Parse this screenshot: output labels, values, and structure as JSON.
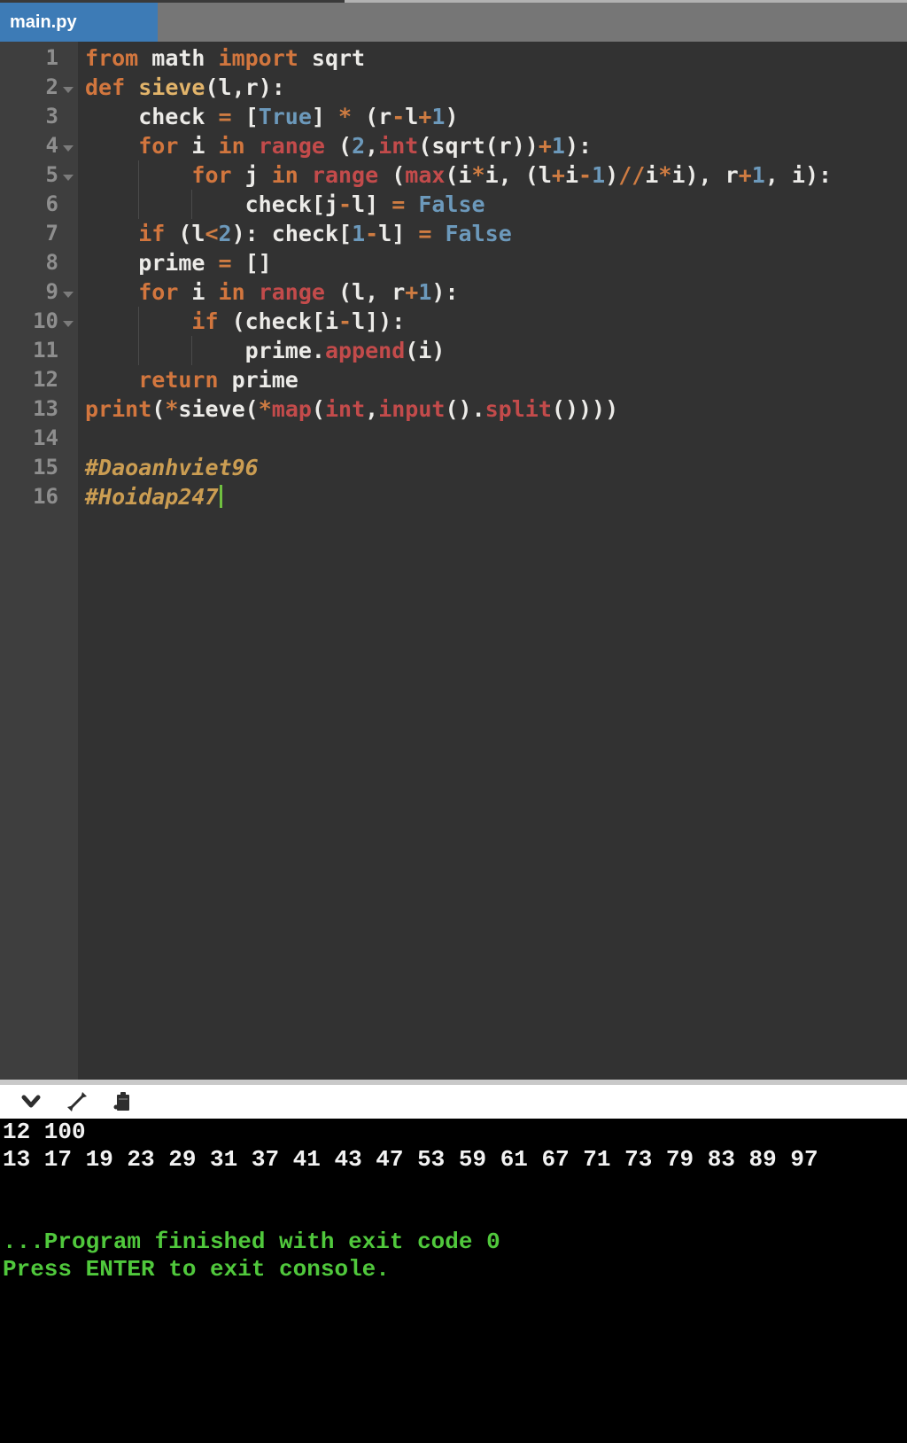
{
  "palette": {
    "tab_blue": "#3d7bb6",
    "editor_bg": "#323232",
    "gutter_bg": "#3e3e3e",
    "linenum": "#8e8e8e",
    "plain": "#ecebe8",
    "keyword": "#d2763e",
    "builtin": "#c34b4b",
    "func_def": "#e2b46a",
    "number": "#6c99bb",
    "operator": "#cf7c42",
    "comment": "#cb9d52",
    "cursor_green": "#70c040",
    "terminal_bg": "#000000",
    "terminal_text": "#f2f2f2",
    "terminal_green": "#50c83c"
  },
  "tab_bar": {
    "active_tab": "main.py"
  },
  "editor": {
    "cursor_line": 16,
    "fold_lines": [
      2,
      4,
      5,
      9,
      10
    ],
    "lines": [
      {
        "n": 1,
        "tokens": [
          [
            "kw",
            "from"
          ],
          [
            "pl",
            " math "
          ],
          [
            "kw",
            "import"
          ],
          [
            "pl",
            " sqrt"
          ]
        ]
      },
      {
        "n": 2,
        "tokens": [
          [
            "kw",
            "def"
          ],
          [
            "pl",
            " "
          ],
          [
            "fn",
            "sieve"
          ],
          [
            "pl",
            "(l,r):"
          ]
        ]
      },
      {
        "n": 3,
        "tokens": [
          [
            "pl",
            "    check "
          ],
          [
            "op",
            "="
          ],
          [
            "pl",
            " ["
          ],
          [
            "const",
            "True"
          ],
          [
            "pl",
            "] "
          ],
          [
            "op",
            "*"
          ],
          [
            "pl",
            " (r"
          ],
          [
            "op",
            "-"
          ],
          [
            "pl",
            "l"
          ],
          [
            "op",
            "+"
          ],
          [
            "num",
            "1"
          ],
          [
            "pl",
            ")"
          ]
        ]
      },
      {
        "n": 4,
        "tokens": [
          [
            "pl",
            "    "
          ],
          [
            "kw",
            "for"
          ],
          [
            "pl",
            " i "
          ],
          [
            "kw",
            "in"
          ],
          [
            "pl",
            " "
          ],
          [
            "bi",
            "range"
          ],
          [
            "pl",
            " ("
          ],
          [
            "num",
            "2"
          ],
          [
            "pl",
            ","
          ],
          [
            "bi",
            "int"
          ],
          [
            "pl",
            "(sqrt(r))"
          ],
          [
            "op",
            "+"
          ],
          [
            "num",
            "1"
          ],
          [
            "pl",
            "):"
          ]
        ]
      },
      {
        "n": 5,
        "tokens": [
          [
            "pl",
            "        "
          ],
          [
            "kw",
            "for"
          ],
          [
            "pl",
            " j "
          ],
          [
            "kw",
            "in"
          ],
          [
            "pl",
            " "
          ],
          [
            "bi",
            "range"
          ],
          [
            "pl",
            " ("
          ],
          [
            "bi",
            "max"
          ],
          [
            "pl",
            "(i"
          ],
          [
            "op",
            "*"
          ],
          [
            "pl",
            "i, (l"
          ],
          [
            "op",
            "+"
          ],
          [
            "pl",
            "i"
          ],
          [
            "op",
            "-"
          ],
          [
            "num",
            "1"
          ],
          [
            "pl",
            ")"
          ],
          [
            "op",
            "//"
          ],
          [
            "pl",
            "i"
          ],
          [
            "op",
            "*"
          ],
          [
            "pl",
            "i), r"
          ],
          [
            "op",
            "+"
          ],
          [
            "num",
            "1"
          ],
          [
            "pl",
            ", i):"
          ]
        ]
      },
      {
        "n": 6,
        "tokens": [
          [
            "pl",
            "            check[j"
          ],
          [
            "op",
            "-"
          ],
          [
            "pl",
            "l] "
          ],
          [
            "op",
            "="
          ],
          [
            "pl",
            " "
          ],
          [
            "const",
            "False"
          ]
        ]
      },
      {
        "n": 7,
        "tokens": [
          [
            "pl",
            "    "
          ],
          [
            "kw",
            "if"
          ],
          [
            "pl",
            " (l"
          ],
          [
            "op",
            "<"
          ],
          [
            "num",
            "2"
          ],
          [
            "pl",
            "): check["
          ],
          [
            "num",
            "1"
          ],
          [
            "op",
            "-"
          ],
          [
            "pl",
            "l] "
          ],
          [
            "op",
            "="
          ],
          [
            "pl",
            " "
          ],
          [
            "const",
            "False"
          ]
        ]
      },
      {
        "n": 8,
        "tokens": [
          [
            "pl",
            "    prime "
          ],
          [
            "op",
            "="
          ],
          [
            "pl",
            " []"
          ]
        ]
      },
      {
        "n": 9,
        "tokens": [
          [
            "pl",
            "    "
          ],
          [
            "kw",
            "for"
          ],
          [
            "pl",
            " i "
          ],
          [
            "kw",
            "in"
          ],
          [
            "pl",
            " "
          ],
          [
            "bi",
            "range"
          ],
          [
            "pl",
            " (l, r"
          ],
          [
            "op",
            "+"
          ],
          [
            "num",
            "1"
          ],
          [
            "pl",
            "):"
          ]
        ]
      },
      {
        "n": 10,
        "tokens": [
          [
            "pl",
            "        "
          ],
          [
            "kw",
            "if"
          ],
          [
            "pl",
            " (check[i"
          ],
          [
            "op",
            "-"
          ],
          [
            "pl",
            "l]):"
          ]
        ]
      },
      {
        "n": 11,
        "tokens": [
          [
            "pl",
            "            prime."
          ],
          [
            "bi",
            "append"
          ],
          [
            "pl",
            "(i)"
          ]
        ]
      },
      {
        "n": 12,
        "tokens": [
          [
            "pl",
            "    "
          ],
          [
            "kw",
            "return"
          ],
          [
            "pl",
            " prime"
          ]
        ]
      },
      {
        "n": 13,
        "tokens": [
          [
            "kw",
            "print"
          ],
          [
            "pl",
            "("
          ],
          [
            "op",
            "*"
          ],
          [
            "pl",
            "sieve("
          ],
          [
            "op",
            "*"
          ],
          [
            "bi",
            "map"
          ],
          [
            "pl",
            "("
          ],
          [
            "bi",
            "int"
          ],
          [
            "pl",
            ","
          ],
          [
            "bi",
            "input"
          ],
          [
            "pl",
            "()."
          ],
          [
            "bi",
            "split"
          ],
          [
            "pl",
            "())))"
          ]
        ]
      },
      {
        "n": 14,
        "tokens": []
      },
      {
        "n": 15,
        "tokens": [
          [
            "com",
            "#Daoanhviet96"
          ]
        ]
      },
      {
        "n": 16,
        "tokens": [
          [
            "com",
            "#Hoidap247"
          ]
        ]
      }
    ]
  },
  "console": {
    "toolbar_icons": [
      "chevron-down",
      "resize-diagonal",
      "paste"
    ],
    "lines": [
      {
        "text": "12 100",
        "color": "white"
      },
      {
        "text": "13 17 19 23 29 31 37 41 43 47 53 59 61 67 71 73 79 83 89 97",
        "color": "white"
      },
      {
        "text": "",
        "color": "white"
      },
      {
        "text": "",
        "color": "white"
      },
      {
        "text": "...Program finished with exit code 0",
        "color": "green"
      },
      {
        "text": "Press ENTER to exit console.",
        "color": "green"
      }
    ]
  }
}
